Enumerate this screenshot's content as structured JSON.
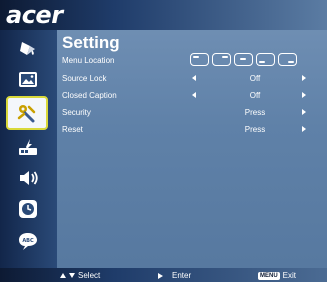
{
  "brand": {
    "logo": "acer"
  },
  "sidebar": {
    "items": [
      {
        "name": "color-icon"
      },
      {
        "name": "image-icon"
      },
      {
        "name": "setting-icon",
        "active": true
      },
      {
        "name": "management-icon"
      },
      {
        "name": "audio-icon"
      },
      {
        "name": "timer-icon"
      },
      {
        "name": "language-icon"
      }
    ]
  },
  "page": {
    "title": "Setting"
  },
  "settings": {
    "menu_location": {
      "label": "Menu Location"
    },
    "source_lock": {
      "label": "Source Lock",
      "value": "Off"
    },
    "closed_caption": {
      "label": "Closed Caption",
      "value": "Off"
    },
    "security": {
      "label": "Security",
      "value": "Press"
    },
    "reset": {
      "label": "Reset",
      "value": "Press"
    }
  },
  "footer": {
    "select_label": "Select",
    "enter_label": "Enter",
    "menu_key": "MENU",
    "exit_label": "Exit"
  },
  "colors": {
    "accent_border": "#d9d93a",
    "background": "#5d7fa5"
  }
}
